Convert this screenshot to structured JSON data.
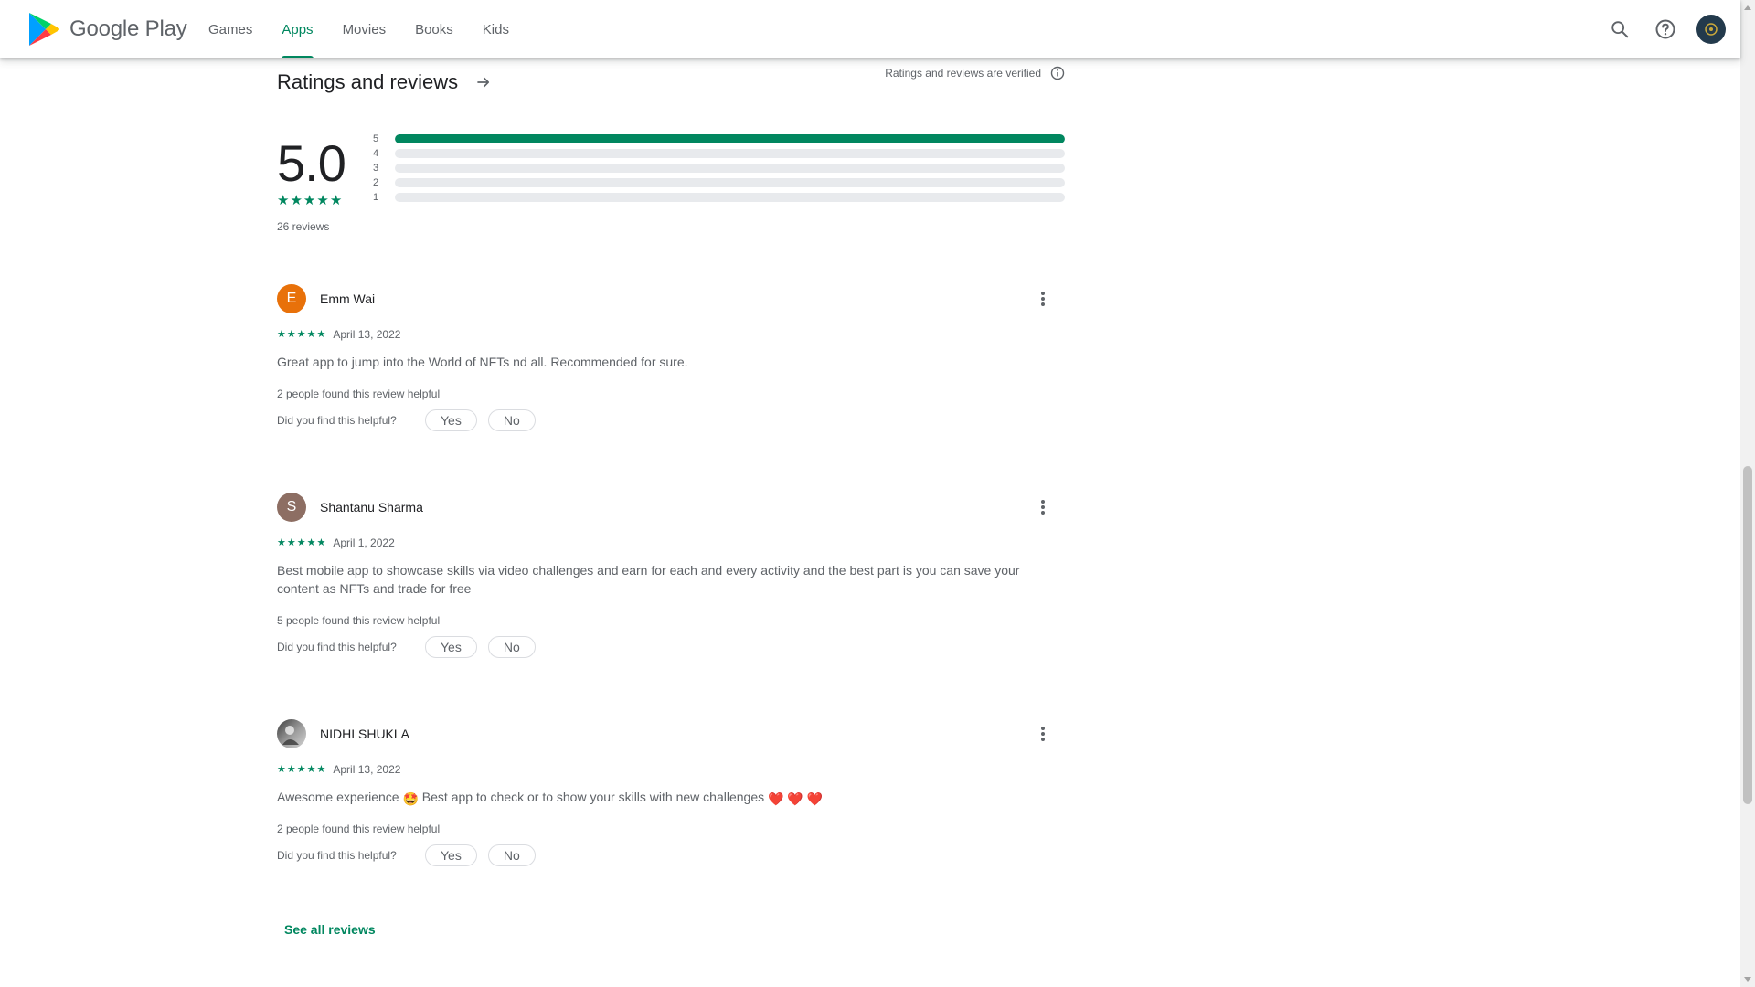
{
  "header": {
    "logo_text": "Google Play",
    "nav": [
      {
        "label": "Games",
        "active": false
      },
      {
        "label": "Apps",
        "active": true
      },
      {
        "label": "Movies",
        "active": false
      },
      {
        "label": "Books",
        "active": false
      },
      {
        "label": "Kids",
        "active": false
      }
    ],
    "icons": [
      "search-icon",
      "help-icon",
      "account-avatar"
    ]
  },
  "ratings": {
    "title": "Ratings and reviews",
    "verified_text": "Ratings and reviews are verified",
    "average": "5.0",
    "stars": 5,
    "review_count": "26 reviews",
    "distribution": [
      {
        "label": "5",
        "fraction": 1.0
      },
      {
        "label": "4",
        "fraction": 0
      },
      {
        "label": "3",
        "fraction": 0
      },
      {
        "label": "2",
        "fraction": 0
      },
      {
        "label": "1",
        "fraction": 0
      }
    ]
  },
  "reviews": [
    {
      "initial": "E",
      "avatar_color": "#e8710a",
      "name": "Emm Wai",
      "stars": 5,
      "date": "April 13, 2022",
      "text": "Great app to jump into the World of NFTs nd all. Recommended for sure.",
      "helpful": "2 people found this review helpful",
      "ask": "Did you find this helpful?",
      "yes": "Yes",
      "no": "No"
    },
    {
      "initial": "S",
      "avatar_color": "#8d6e63",
      "name": "Shantanu Sharma",
      "stars": 5,
      "date": "April 1, 2022",
      "text": "Best mobile app to showcase skills via video challenges and earn for each and every activity and the best part is you can save your content as NFTs and trade for free",
      "helpful": "5 people found this review helpful",
      "ask": "Did you find this helpful?",
      "yes": "Yes",
      "no": "No"
    },
    {
      "initial": "",
      "avatar_color": "#6b6b6b",
      "name": "NIDHI SHUKLA",
      "stars": 5,
      "date": "April 13, 2022",
      "text_parts": [
        "Awesome experience ",
        "🤩",
        " Best app to check or to show your skills with new challenges ",
        "❤️",
        " ",
        "❤️",
        " ",
        "❤️"
      ],
      "helpful": "2 people found this review helpful",
      "ask": "Did you find this helpful?",
      "yes": "Yes",
      "no": "No"
    }
  ],
  "see_all": "See all reviews",
  "colors": {
    "accent": "#01875f",
    "text_secondary": "#5f6368",
    "track": "#e8eaed"
  }
}
